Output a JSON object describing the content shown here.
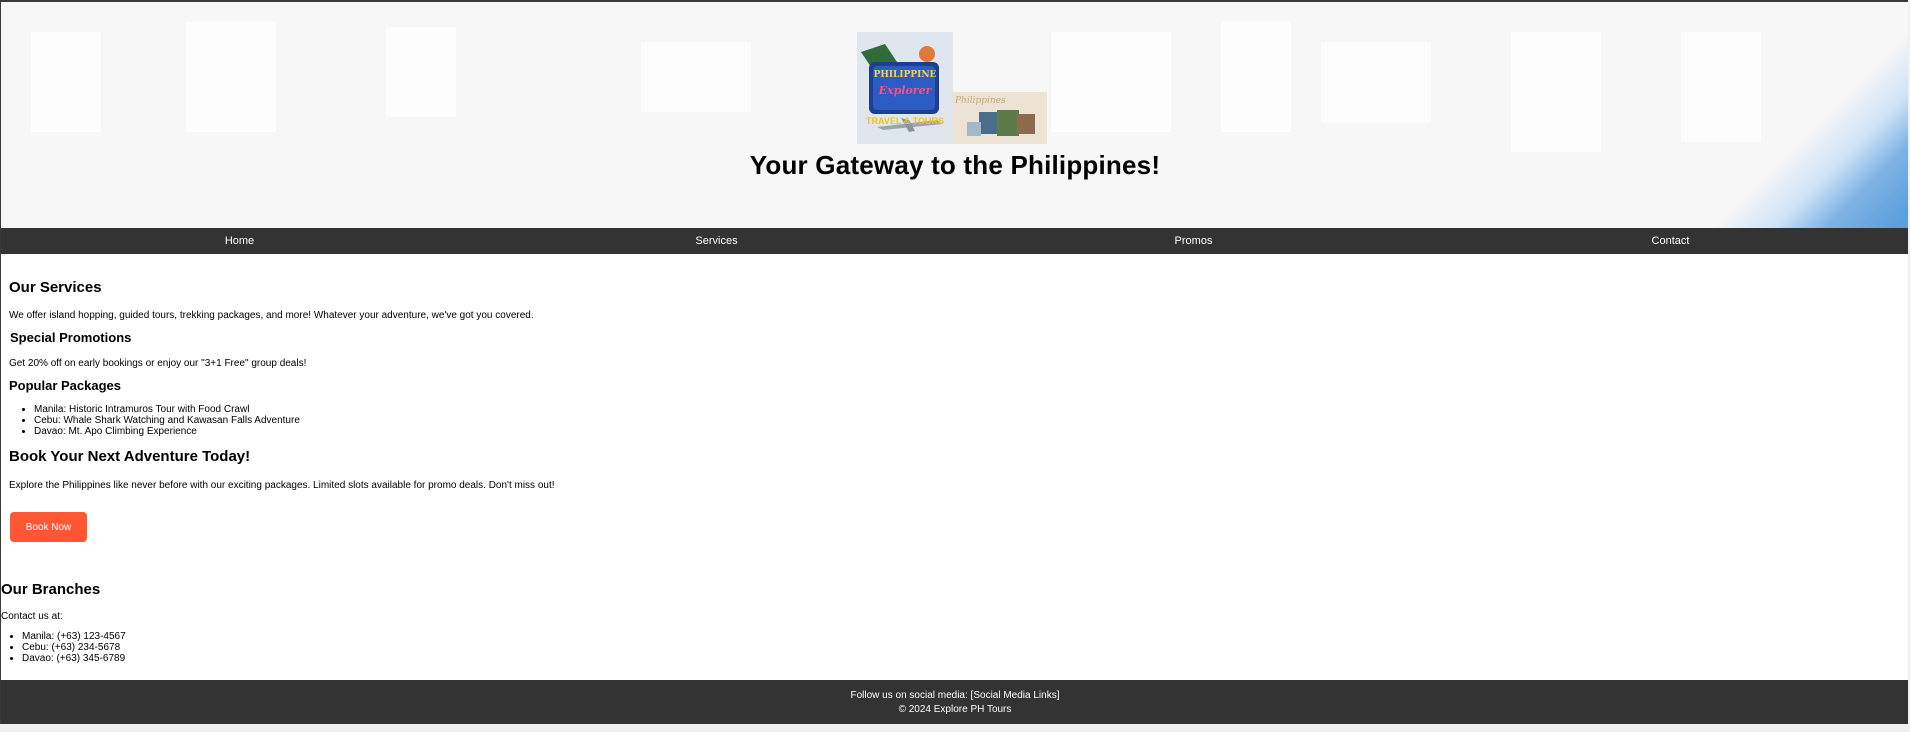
{
  "hero": {
    "title": "Your Gateway to the Philippines!",
    "logo_main": {
      "line1": "PHILIPPINE",
      "line2": "Explorer",
      "line3": "TRAVEL & TOURS"
    },
    "logo_secondary": {
      "text": "Philippines"
    }
  },
  "nav": {
    "items": [
      {
        "label": "Home"
      },
      {
        "label": "Services"
      },
      {
        "label": "Promos"
      },
      {
        "label": "Contact"
      }
    ]
  },
  "services": {
    "heading": "Our Services",
    "text": "We offer island hopping, guided tours, trekking packages, and more! Whatever your adventure, we've got you covered."
  },
  "promotions": {
    "heading": "Special Promotions",
    "text": "Get 20% off on early bookings or enjoy our \"3+1 Free\" group deals!"
  },
  "packages": {
    "heading": "Popular Packages",
    "items": [
      "Manila: Historic Intramuros Tour with Food Crawl",
      "Cebu: Whale Shark Watching and Kawasan Falls Adventure",
      "Davao: Mt. Apo Climbing Experience"
    ]
  },
  "cta": {
    "heading": "Book Your Next Adventure Today!",
    "text": "Explore the Philippines like never before with our exciting packages. Limited slots available for promo deals. Don't miss out!",
    "button_label": "Book Now",
    "button_color": "#ff5733"
  },
  "branches": {
    "heading": "Our Branches",
    "intro": "Contact us at:",
    "items": [
      "Manila: (+63) 123-4567",
      "Cebu: (+63) 234-5678",
      "Davao: (+63) 345-6789"
    ]
  },
  "footer": {
    "social": "Follow us on social media: [Social Media Links]",
    "copyright": "© 2024 Explore PH Tours"
  },
  "colors": {
    "nav_bg": "#333333",
    "footer_bg": "#333333",
    "accent": "#ff5733"
  }
}
